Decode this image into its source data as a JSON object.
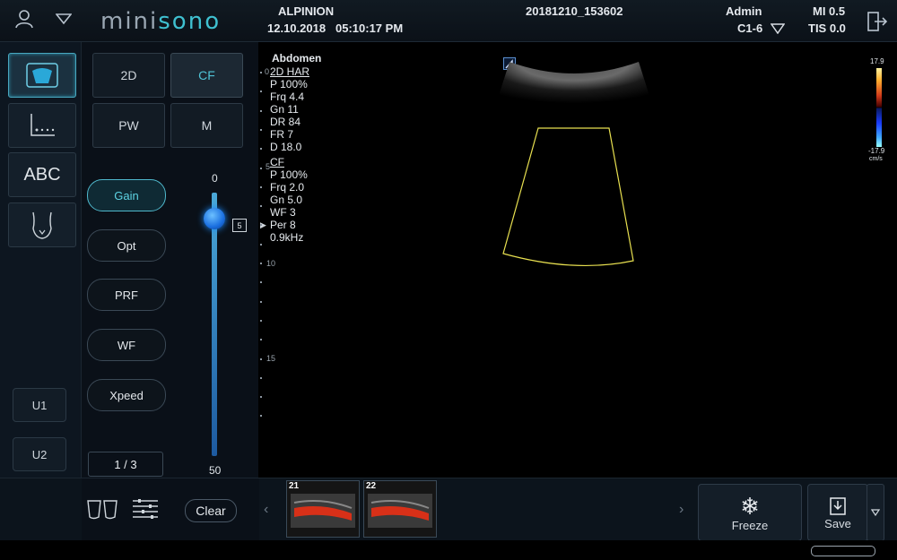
{
  "header": {
    "logo_main": "mini",
    "logo_accent": "sono",
    "institution": "ALPINION",
    "date": "12.10.2018",
    "time": "05:10:17 PM",
    "study_id": "20181210_153602",
    "user": "Admin",
    "probe": "C1-6",
    "mi": "MI 0.5",
    "tis": "TIS 0.0"
  },
  "left_tools": {
    "abc_label": "ABC",
    "user_buttons": [
      "U1",
      "U2"
    ]
  },
  "modes": {
    "b2d": "2D",
    "cf": "CF",
    "pw": "PW",
    "m": "M"
  },
  "pills": [
    "Gain",
    "Opt",
    "PRF",
    "WF",
    "Xpeed"
  ],
  "pager": "1 / 3",
  "slider": {
    "top_label": "0",
    "bottom_label": "50",
    "value_label": "5",
    "level_fraction": 0.1
  },
  "info": {
    "preset": "Abdomen",
    "b_title": "2D HAR",
    "b_params": [
      "P 100%",
      "Frq 4.4",
      "Gn 11",
      "DR 84",
      "FR 7",
      "D 18.0"
    ],
    "cf_title": "CF",
    "cf_params": [
      "P 100%",
      "Frq 2.0",
      "Gn 5.0",
      "WF 3",
      "Per 8",
      "0.9kHz"
    ]
  },
  "depth_scale": {
    "labels": [
      "0",
      "5",
      "10",
      "15"
    ]
  },
  "colorbar": {
    "max": "17.9",
    "min": "-17.9",
    "unit": "cm/s"
  },
  "bottom": {
    "clear_label": "Clear",
    "thumbnails": [
      "21",
      "22"
    ],
    "freeze_label": "Freeze",
    "save_label": "Save"
  },
  "colors": {
    "accent": "#4fc3d6",
    "roi": "#e8e050",
    "slider": "#1a6fe0"
  },
  "icons": [
    "user-icon",
    "dropdown-icon",
    "exit-icon",
    "probe-icon",
    "measure-icon",
    "body-mark-icon",
    "keyboard-icon",
    "dual-view-icon",
    "list-settings-icon",
    "snowflake-icon",
    "save-icon",
    "chevron-left-icon",
    "chevron-right-icon"
  ]
}
